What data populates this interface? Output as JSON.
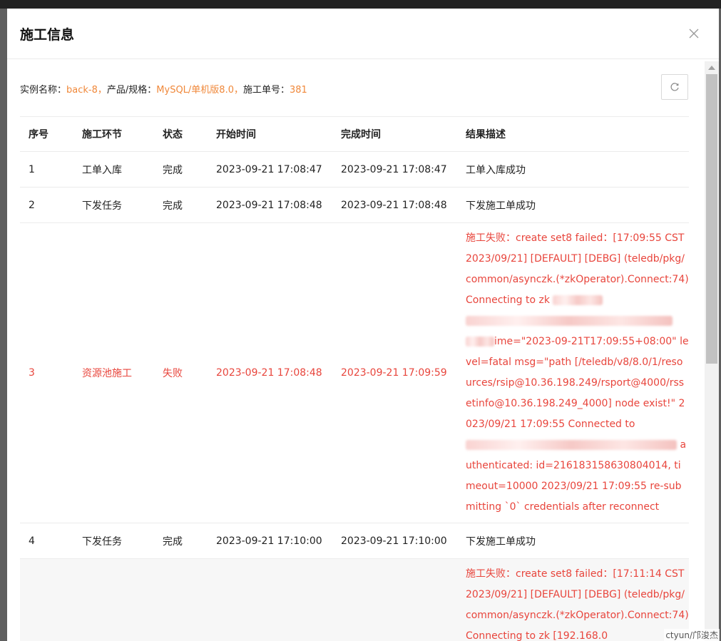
{
  "modal": {
    "title": "施工信息"
  },
  "info": {
    "instance_label": "实例名称：",
    "instance_value": "back-8",
    "sep1": "，",
    "spec_label": "产品/规格：",
    "spec_value": "MySQL/单机版8.0",
    "sep2": "，",
    "order_label": "施工单号：",
    "order_value": "381"
  },
  "table": {
    "headers": [
      "序号",
      "施工环节",
      "状态",
      "开始时间",
      "完成时间",
      "结果描述"
    ],
    "rows": [
      {
        "no": "1",
        "step": "工单入库",
        "status": "完成",
        "start": "2023-09-21 17:08:47",
        "end": "2023-09-21 17:08:47",
        "desc": "工单入库成功"
      },
      {
        "no": "2",
        "step": "下发任务",
        "status": "完成",
        "start": "2023-09-21 17:08:48",
        "end": "2023-09-21 17:08:48",
        "desc": "下发施工单成功"
      },
      {
        "no": "3",
        "step": "资源池施工",
        "status": "失败",
        "start": "2023-09-21 17:08:48",
        "end": "2023-09-21 17:09:59",
        "desc_a": "施工失败：create set8 failed：[17:09:55 CST 2023/09/21] [DEFAULT] [DEBG] (teledb/pkg/common/asynczk.(*zkOperator).Connect:74) Connecting to zk",
        "desc_b": "ime=\"2023-09-21T17:09:55+08:00\" level=fatal msg=\"path [/teledb/v8/8.0/1/resources/rsip@10.36.198.249/rsport@4000/rssetinfo@10.36.198.249_4000] node exist!\" 2023/09/21 17:09:55 Connected to",
        "desc_c": "authenticated: id=216183158630804014, timeout=10000 2023/09/21 17:09:55 re-submitting `0` credentials after reconnect"
      },
      {
        "no": "4",
        "step": "下发任务",
        "status": "完成",
        "start": "2023-09-21 17:10:00",
        "end": "2023-09-21 17:10:00",
        "desc": "下发施工单成功"
      },
      {
        "desc_a": "施工失败：create set8 failed：[17:11:14 CST 2023/09/21] [DEFAULT] [DEBG] (teledb/pkg/common/asynczk.(*zkOperator).Connect:74) Connecting to zk [192.168.0"
      }
    ]
  },
  "watermark": "ctyun/邝浚杰"
}
